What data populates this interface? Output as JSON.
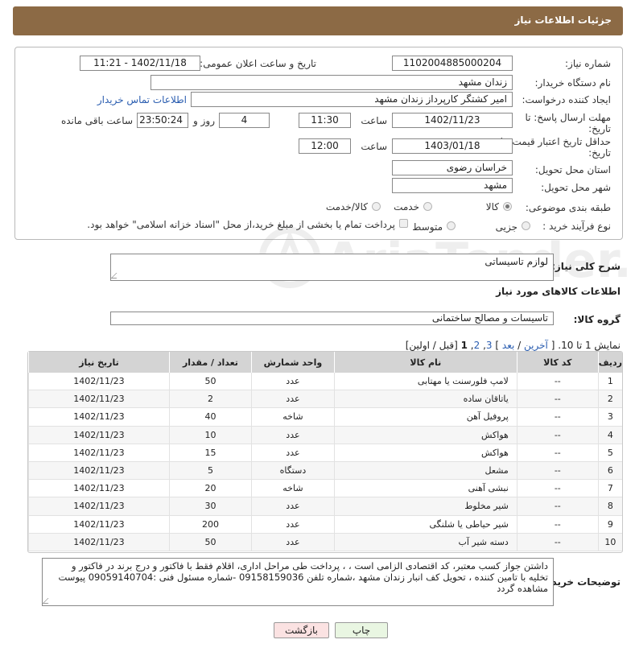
{
  "header": {
    "title": "جزئیات اطلاعات نیاز"
  },
  "form": {
    "need_number_label": "شماره نیاز:",
    "need_number": "1102004885000204",
    "announce_label": "تاریخ و ساعت اعلان عمومی:",
    "announce_value": "1402/11/18 - 11:21",
    "buyer_org_label": "نام دستگاه خریدار:",
    "buyer_org": "زندان مشهد",
    "creator_label": "ایجاد کننده درخواست:",
    "creator": "امیر کشتگر کارپرداز زندان مشهد",
    "contact_link": "اطلاعات تماس خریدار",
    "deadline_label_1": "مهلت ارسال پاسخ: تا",
    "deadline_label_2": "تاریخ:",
    "deadline_date": "1402/11/23",
    "time_label": "ساعت",
    "deadline_time": "11:30",
    "days_value": "4",
    "days_label": "روز و",
    "remaining_time": "23:50:24",
    "remaining_label": "ساعت باقی مانده",
    "validity_label_1": "حداقل تاریخ اعتبار قیمت: تا",
    "validity_label_2": "تاریخ:",
    "validity_date": "1403/01/18",
    "validity_time": "12:00",
    "province_label": "استان محل تحویل:",
    "province": "خراسان رضوی",
    "city_label": "شهر محل تحویل:",
    "city": "مشهد",
    "category_label": "طبقه بندی موضوعی:",
    "category_options": [
      "کالا",
      "خدمت",
      "کالا/خدمت"
    ],
    "category_selected": "کالا",
    "process_label": "نوع فرآیند خرید :",
    "process_options": [
      "جزیی",
      "متوسط"
    ],
    "payment_note": "پرداخت تمام یا بخشی از مبلغ خرید،از محل \"اسناد خزانه اسلامی\" خواهد بود."
  },
  "watermark": {
    "text": "AriaTender.neT"
  },
  "description": {
    "label": "شرح کلی نیاز:",
    "value": "لوازم تاسیساتی"
  },
  "goods_section": {
    "title": "اطلاعات کالاهای مورد نیاز",
    "group_label": "گروه کالا:",
    "group_value": "تاسیسات و مصالح ساختمانی"
  },
  "pagination": {
    "showing": "نمایش 1 تا 10.",
    "open": "[",
    "last": "آخرین",
    "sep1": "/",
    "next": "بعد",
    "sep2": "]",
    "page3": "3",
    "comma1": ",",
    "page2": "2",
    "comma2": ",",
    "page1": "1",
    "tail": "[قبل / اولین]"
  },
  "table": {
    "headers": [
      "ردیف",
      "کد کالا",
      "نام کالا",
      "واحد شمارش",
      "تعداد / مقدار",
      "تاریخ نیاز"
    ],
    "rows": [
      [
        "1",
        "--",
        "لامپ فلورسنت یا مهتابی",
        "عدد",
        "50",
        "1402/11/23"
      ],
      [
        "2",
        "--",
        "یاتاقان ساده",
        "عدد",
        "2",
        "1402/11/23"
      ],
      [
        "3",
        "--",
        "پروفیل آهن",
        "شاخه",
        "40",
        "1402/11/23"
      ],
      [
        "4",
        "--",
        "هواکش",
        "عدد",
        "10",
        "1402/11/23"
      ],
      [
        "5",
        "--",
        "هواکش",
        "عدد",
        "15",
        "1402/11/23"
      ],
      [
        "6",
        "--",
        "مشعل",
        "دستگاه",
        "5",
        "1402/11/23"
      ],
      [
        "7",
        "--",
        "نبشی آهنی",
        "شاخه",
        "20",
        "1402/11/23"
      ],
      [
        "8",
        "--",
        "شیر مخلوط",
        "عدد",
        "30",
        "1402/11/23"
      ],
      [
        "9",
        "--",
        "شیر حیاطی یا شلنگی",
        "عدد",
        "200",
        "1402/11/23"
      ],
      [
        "10",
        "--",
        "دسته شیر آب",
        "عدد",
        "50",
        "1402/11/23"
      ]
    ]
  },
  "buyer_notes": {
    "label": "توضیحات خریدار:",
    "line1": "داشتن جواز کسب معتبر، کد اقتصادی الزامی است ، ، پرداخت طی مراحل اداری، اقلام فقط با فاکتور و درج برند در فاکتور  و",
    "line2": "تخلیه با تامین کننده ، تحویل کف انبار زندان مشهد ،شماره تلفن 09158159036 -شماره مسئول فنی :09059140704 پیوست",
    "line3": "مشاهده گردد"
  },
  "buttons": {
    "print": "چاپ",
    "back": "بازگشت"
  },
  "colors": {
    "header_bg": "#8c6a45",
    "print_bg": "#e9f6e2",
    "back_bg": "#fbe2e2",
    "link": "#2a5db0"
  }
}
